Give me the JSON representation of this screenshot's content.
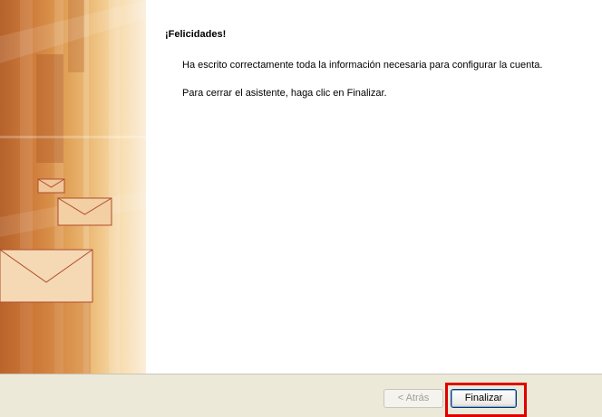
{
  "wizard": {
    "title": "¡Felicidades!",
    "message_line1": "Ha escrito correctamente toda la información necesaria para configurar la cuenta.",
    "message_line2": "Para cerrar el asistente, haga clic en Finalizar."
  },
  "buttons": {
    "back_label": "< Atrás",
    "finish_label": "Finalizar"
  },
  "colors": {
    "highlight": "#e00000",
    "banner_accent": "#cf7c3a"
  },
  "icons": [
    "envelope-icon"
  ]
}
